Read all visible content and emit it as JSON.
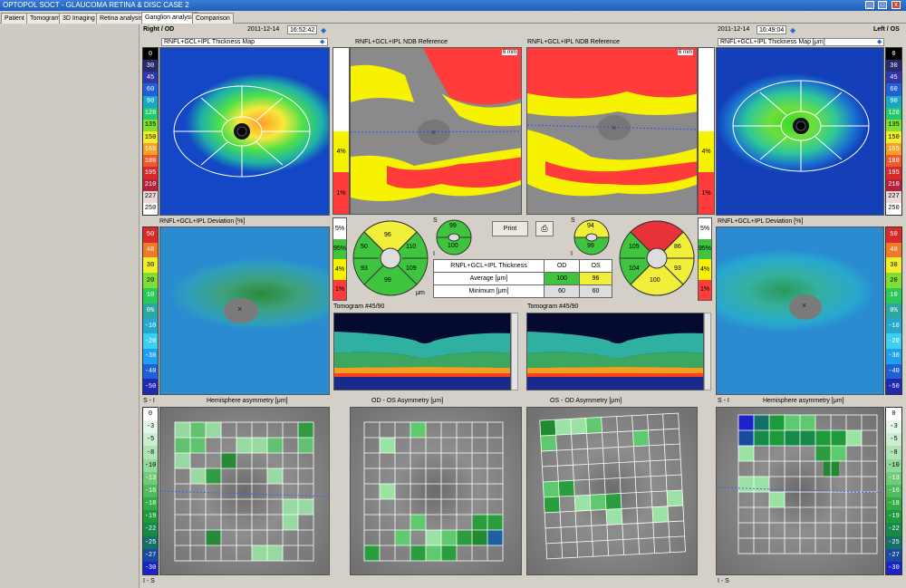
{
  "window": {
    "title": "OPTOPOL SOCT - GLAUCOMA RETINA & DISC CASE 2",
    "min": "_",
    "max": "□",
    "close": "x"
  },
  "tabs": [
    {
      "label": "Patient"
    },
    {
      "label": "Tomogram"
    },
    {
      "label": "3D Imaging"
    },
    {
      "label": "Retina analysis"
    },
    {
      "label": "Ganglion analysis"
    },
    {
      "label": "Comparison"
    }
  ],
  "active_tab": "Ganglion analysis",
  "right_eye": {
    "eye_label": "Right / OD",
    "date": "2011-12-14",
    "time": "16:52:42",
    "thickness_title": "RNFL+GCL+IPL Thickness Map",
    "deviation_title": "RNFL+GCL+IPL Deviation [%]",
    "hemi_title": "Hemisphere asymmetry [μm]",
    "hemi_top": "S - I",
    "hemi_bottom": "I - S"
  },
  "left_eye": {
    "eye_label": "Left / OS",
    "date": "2011-12-14",
    "time": "16:49:04",
    "thickness_title": "RNFL+GCL+IPL Thickness Map [μm]",
    "deviation_title": "RNFL+GCL+IPL Deviation [%]",
    "hemi_title": "Hemisphere asymmetry [μm]",
    "hemi_top": "S - I",
    "hemi_bottom": "I - S"
  },
  "thickness_scale": [
    "0",
    "30",
    "45",
    "60",
    "90",
    "120",
    "135",
    "150",
    "165",
    "180",
    "195",
    "210",
    "227",
    "250"
  ],
  "deviation_scale": [
    "50",
    "40",
    "30",
    "20",
    "10",
    "0%",
    "-10",
    "-20",
    "-30",
    "-40",
    "-50"
  ],
  "asym_scale_left": [
    "0",
    "-3",
    "-5",
    "-8",
    "-10",
    "-13",
    "-16",
    "-18",
    "-19",
    "-22",
    "-25",
    "-27",
    "-30"
  ],
  "asym_scale_right": [
    "0",
    "-3",
    "-5",
    "-8",
    "-10",
    "-13",
    "-16",
    "-18",
    "-19",
    "-22",
    "-25",
    "-27",
    "-30"
  ],
  "ndb": {
    "od_title": "RNFL+GCL+IPL NDB Reference",
    "os_title": "RNFL+GCL+IPL NDB Reference",
    "scale_mm": "6 mm",
    "bar_labels": [
      "4%",
      "1%"
    ],
    "legend": [
      "5%",
      "95%",
      "4%",
      "1%"
    ]
  },
  "sectors": {
    "od": {
      "top": "96",
      "left": "93",
      "right": "110",
      "bottom_left": "93",
      "bottom_right": "109",
      "bottom": "99",
      "upper_left": "50"
    },
    "od_hemi": {
      "top": "99",
      "bottom": "100"
    },
    "os_hemi": {
      "top": "94",
      "bottom": "99"
    },
    "os": {
      "left": "105",
      "right": "86",
      "bottom_left": "104",
      "bottom_right": "93",
      "bottom": "100"
    },
    "unit": "μm",
    "label_s": "S",
    "label_i": "I"
  },
  "thickness_table": {
    "header": [
      "RNFL+GCL+IPL Thickness",
      "OD",
      "OS"
    ],
    "rows": [
      {
        "label": "Average [μm]",
        "od": "100",
        "os": "96"
      },
      {
        "label": "Minimum [μm]",
        "od": "60",
        "os": "60"
      }
    ]
  },
  "print_label": "Print",
  "tomogram": {
    "od_title": "Tomogram #45/90",
    "os_title": "Tomogram #45/90"
  },
  "asymmetry": {
    "od_os_title": "OD - OS Asymmetry [μm]",
    "os_od_title": "OS - OD Asymmetry [μm]"
  },
  "colors": {
    "titlebar": "#2a6cc4",
    "red": "#e8323a",
    "yellow": "#f2ef3a",
    "green": "#3ec43e",
    "ndb_red": "#ff3b3b",
    "ndb_yellow": "#f7f200"
  }
}
